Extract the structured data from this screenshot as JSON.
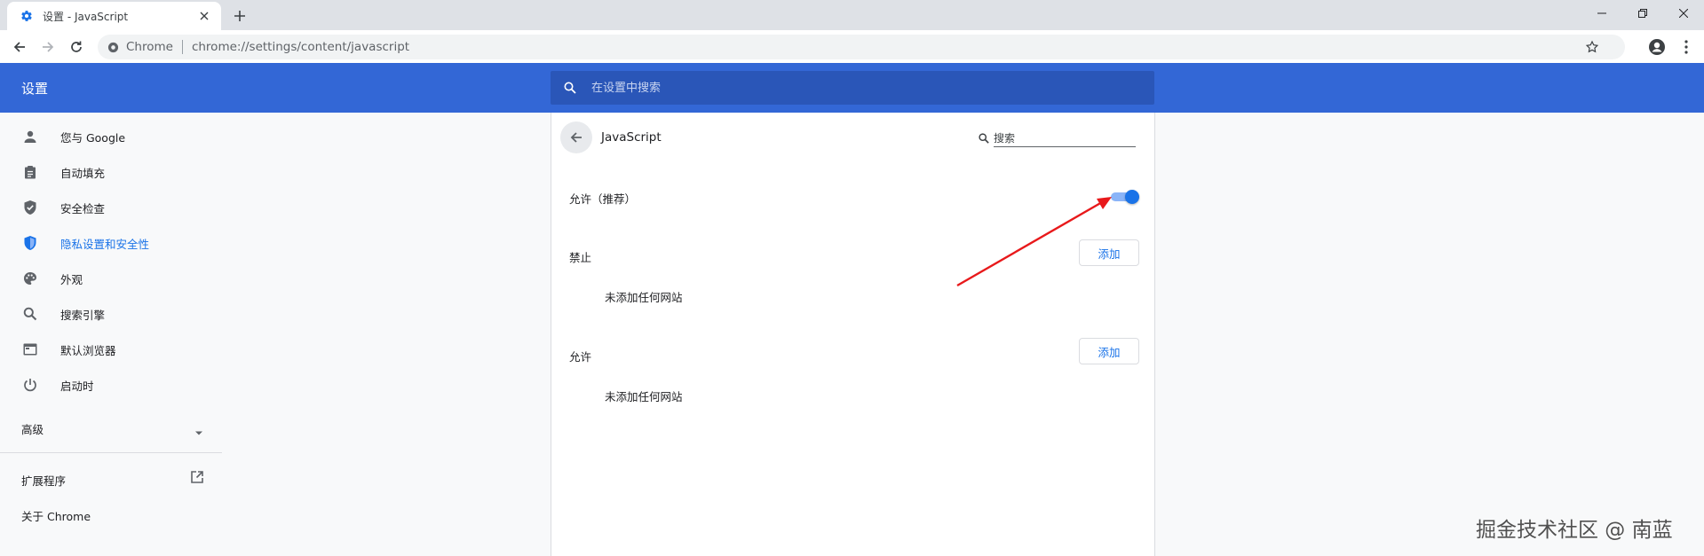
{
  "window": {
    "tab_title": "设置 - JavaScript"
  },
  "toolbar": {
    "site_chip": "Chrome",
    "url": "chrome://settings/content/javascript"
  },
  "header": {
    "title": "设置",
    "search_placeholder": "在设置中搜索"
  },
  "sidebar": {
    "items": [
      {
        "label": "您与 Google",
        "icon": "person-icon"
      },
      {
        "label": "自动填充",
        "icon": "clipboard-icon"
      },
      {
        "label": "安全检查",
        "icon": "shield-check-icon"
      },
      {
        "label": "隐私设置和安全性",
        "icon": "shield-icon",
        "active": true
      },
      {
        "label": "外观",
        "icon": "palette-icon"
      },
      {
        "label": "搜索引擎",
        "icon": "search-icon"
      },
      {
        "label": "默认浏览器",
        "icon": "browser-icon"
      },
      {
        "label": "启动时",
        "icon": "power-icon"
      }
    ],
    "advanced": "高级",
    "extensions": "扩展程序",
    "about": "关于 Chrome"
  },
  "page": {
    "title": "JavaScript",
    "search_placeholder": "搜索",
    "allow_recommended": "允许（推荐）",
    "toggle_on": true,
    "block_label": "禁止",
    "allow_label": "允许",
    "add_button": "添加",
    "empty_text": "未添加任何网站"
  },
  "colors": {
    "header_blue": "#3367d6",
    "accent": "#1a73e8",
    "annotation_arrow": "#e8191b"
  },
  "watermark": "掘金技术社区 @ 南蓝"
}
